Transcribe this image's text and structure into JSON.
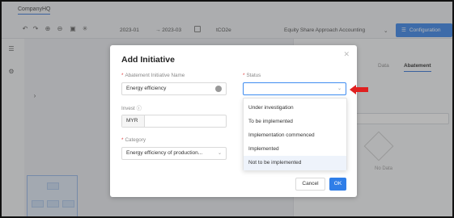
{
  "app": {
    "title": "CompanyHQ"
  },
  "toolbar": {
    "start_period": "2023-01",
    "end_period": "→ 2023-03",
    "unit": "tCO2e",
    "approach": "Equity Share Approach Accounting",
    "config_label": "Configuration",
    "icons": [
      "undo-icon",
      "redo-icon",
      "zoom-in-icon",
      "zoom-out-icon",
      "export-icon",
      "settings-icon"
    ]
  },
  "right_panel": {
    "tabs": [
      "Data",
      "Abatement"
    ],
    "active_tab": "Abatement",
    "no_data": "No Data"
  },
  "modal": {
    "title": "Add Initiative",
    "name_label": "Abatement Initiative Name",
    "name_value": "Energy efficiency",
    "status_label": "Status",
    "status_value": "",
    "invest_label": "Invest",
    "invest_currency": "MYR",
    "invest_value": "",
    "category_label": "Category",
    "category_value": "Energy efficiency of production...",
    "cancel_label": "Cancel",
    "ok_label": "OK"
  },
  "status_dropdown": {
    "options": [
      "Under investigation",
      "To be implemented",
      "Implementation commenced",
      "Implemented",
      "Not to be implemented"
    ],
    "hovered_index": 4
  },
  "colors": {
    "accent": "#2f7ee8",
    "required": "#e04040",
    "arrow": "#e02020"
  }
}
